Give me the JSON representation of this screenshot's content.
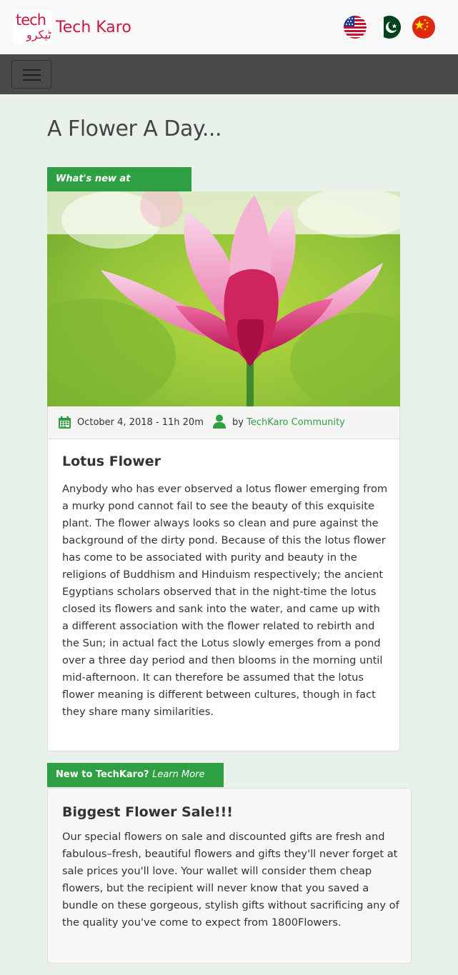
{
  "header": {
    "logo_tech": "tech",
    "logo_urdu": "ٹیکرو",
    "brand": "Tech Karo",
    "flags": [
      "us-flag-icon",
      "pakistan-flag-icon",
      "china-flag-icon"
    ]
  },
  "navbar": {
    "toggler_icon": "hamburger-menu-icon"
  },
  "page": {
    "title": "A Flower A Day..."
  },
  "post": {
    "tag": "What's new at TechKaro?",
    "image_icon": "lotus-flower-image",
    "date": "October 4, 2018 - 11h 20m",
    "by_label": "by",
    "author": "TechKaro Community",
    "title": "Lotus Flower",
    "body": "Anybody who has ever observed a lotus flower emerging from a murky pond cannot fail to see the beauty of this exquisite plant. The flower always looks so clean and pure against the background of the dirty pond. Because of this the lotus flower has come to be associated with purity and beauty in the religions of Buddhism and Hinduism respectively; the ancient Egyptians scholars observed that in the night-time the lotus closed its flowers and sank into the water, and came up with a different association with the flower related to rebirth and the Sun; in actual fact the Lotus slowly emerges from a pond over a three day period and then blooms in the morning until mid-afternoon. It can therefore be assumed that the lotus flower meaning is different between cultures, though in fact they share many similarities."
  },
  "promo": {
    "tag_main": "New to TechKaro?",
    "tag_link": "Learn More >",
    "title": "Biggest Flower Sale!!!",
    "body": "Our special flowers on sale and discounted gifts are fresh and fabulous–fresh, beautiful flowers and gifts they'll never forget at sale prices you'll love. Your wallet will consider them cheap flowers, but the recipient will never know that you saved a bundle on these gorgeous, stylish gifts without sacrificing any of the quality you've come to expect from 1800Flowers."
  },
  "colors": {
    "brand": "#c8193f",
    "accent_green": "#2ea043",
    "navbar": "#4a4a4a",
    "background": "#e9f2ea"
  }
}
